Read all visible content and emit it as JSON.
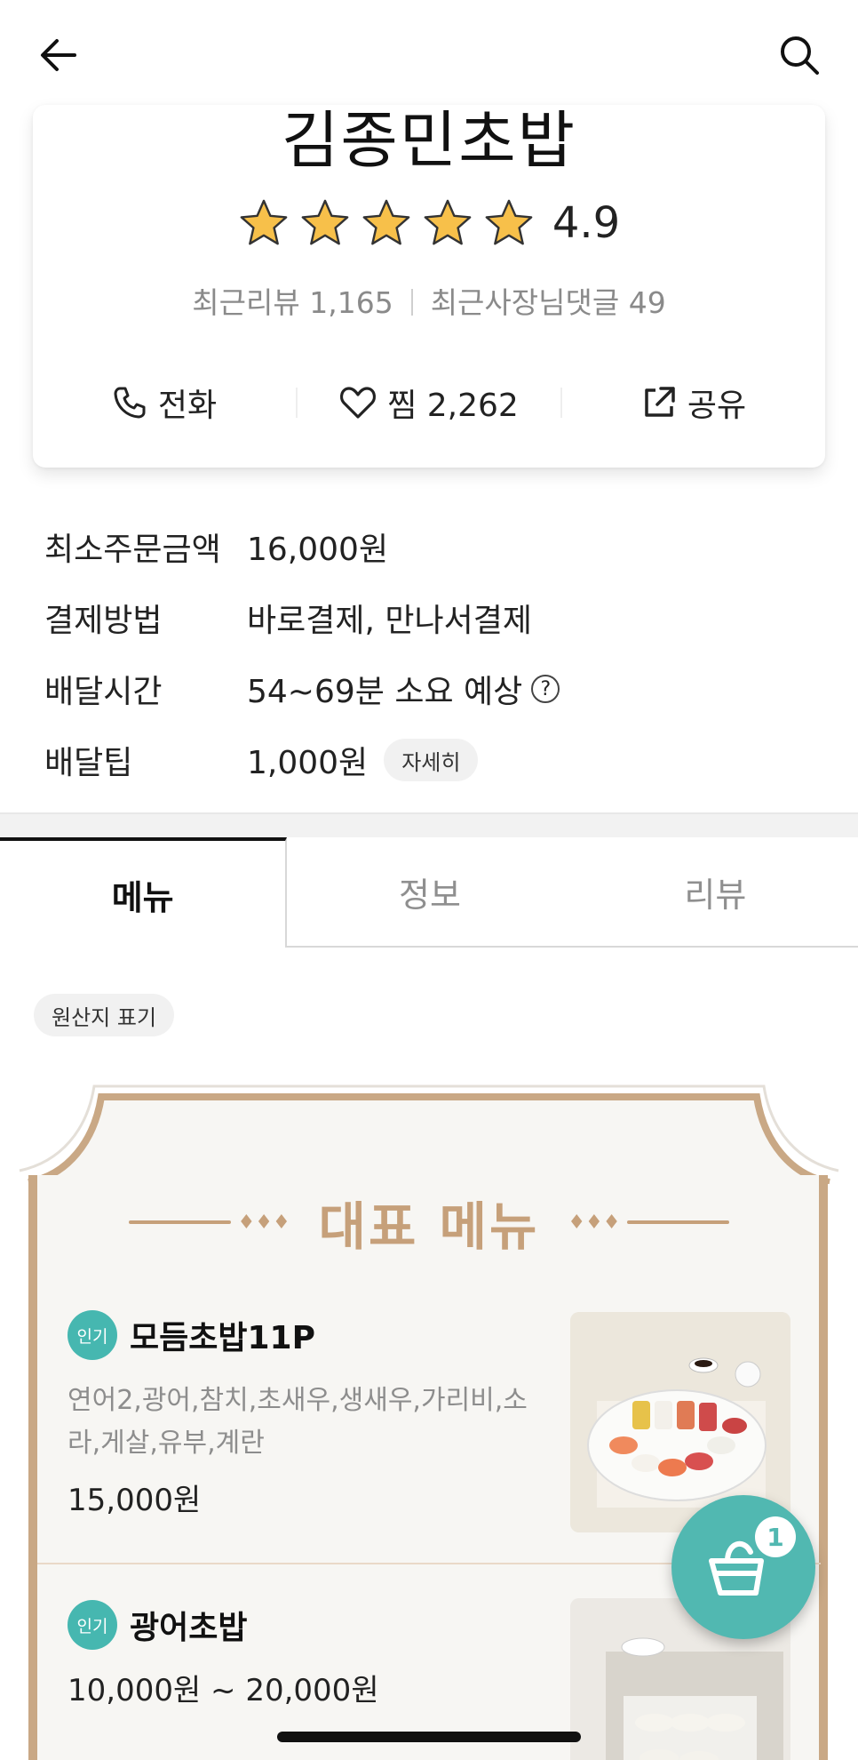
{
  "nav": {
    "back_icon": "arrow-left-icon",
    "search_icon": "search-icon"
  },
  "store": {
    "name": "김종민초밥",
    "rating": "4.9",
    "stars": 5,
    "reviews": "최근리뷰 1,165",
    "owner_replies": "최근사장님댓글 49"
  },
  "actions": {
    "call": "전화",
    "like": "찜 2,262",
    "share": "공유"
  },
  "info": [
    {
      "label": "최소주문금액",
      "value": "16,000원"
    },
    {
      "label": "결제방법",
      "value": "바로결제, 만나서결제"
    },
    {
      "label": "배달시간",
      "value": "54~69분 소요 예상",
      "help": "?"
    },
    {
      "label": "배달팁",
      "value": "1,000원",
      "button": "자세히"
    }
  ],
  "tabs": [
    {
      "label": "메뉴"
    },
    {
      "label": "정보"
    },
    {
      "label": "리뷰"
    }
  ],
  "origin_chip": "원산지 표기",
  "featured": {
    "title": "대표 메뉴",
    "items": [
      {
        "badge": "인기",
        "name": "모듬초밥11P",
        "description": "연어2,광어,참치,초새우,생새우,가리비,소라,게살,유부,계란",
        "price": "15,000원"
      },
      {
        "badge": "인기",
        "name": "광어초밥",
        "price": "10,000원 ~ 20,000원"
      }
    ]
  },
  "cart": {
    "count": "1"
  },
  "colors": {
    "accent": "#51b8b1",
    "gold": "#c6a07a",
    "star": "#f7c04a"
  }
}
